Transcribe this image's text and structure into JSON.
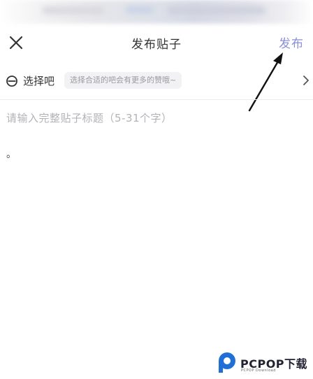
{
  "header": {
    "title": "发布贴子",
    "publish_label": "发布"
  },
  "bar_selector": {
    "label": "选择吧",
    "hint": "选择合适的吧会有更多的赞哦~"
  },
  "editor": {
    "title_placeholder": "请输入完整贴子标题（5-31个字）",
    "body_text": "。"
  },
  "watermark": {
    "brand": "PCPOP下载",
    "sub": "PCPOP Download"
  },
  "colors": {
    "accent": "#8a8fd8",
    "placeholder": "#b3b3b8",
    "hint_bg": "#f2f2f4"
  },
  "icons": [
    "close-icon",
    "forum-circle-icon",
    "chevron-right-icon",
    "pcpop-logo-icon"
  ]
}
